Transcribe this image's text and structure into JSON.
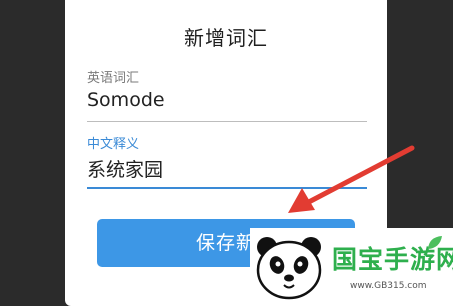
{
  "dialog": {
    "title": "新增词汇",
    "english_field": {
      "label": "英语词汇",
      "value": "Somode"
    },
    "chinese_field": {
      "label": "中文释义",
      "value": "系统家园"
    },
    "save_button_label": "保存新"
  },
  "watermark": {
    "title": "国宝手游网",
    "url": "www.GB315.com"
  },
  "colors": {
    "accent": "#3a8ad6",
    "button": "#3d97e6",
    "arrow": "#e23c32",
    "watermark_green": "#2eaf4d"
  }
}
